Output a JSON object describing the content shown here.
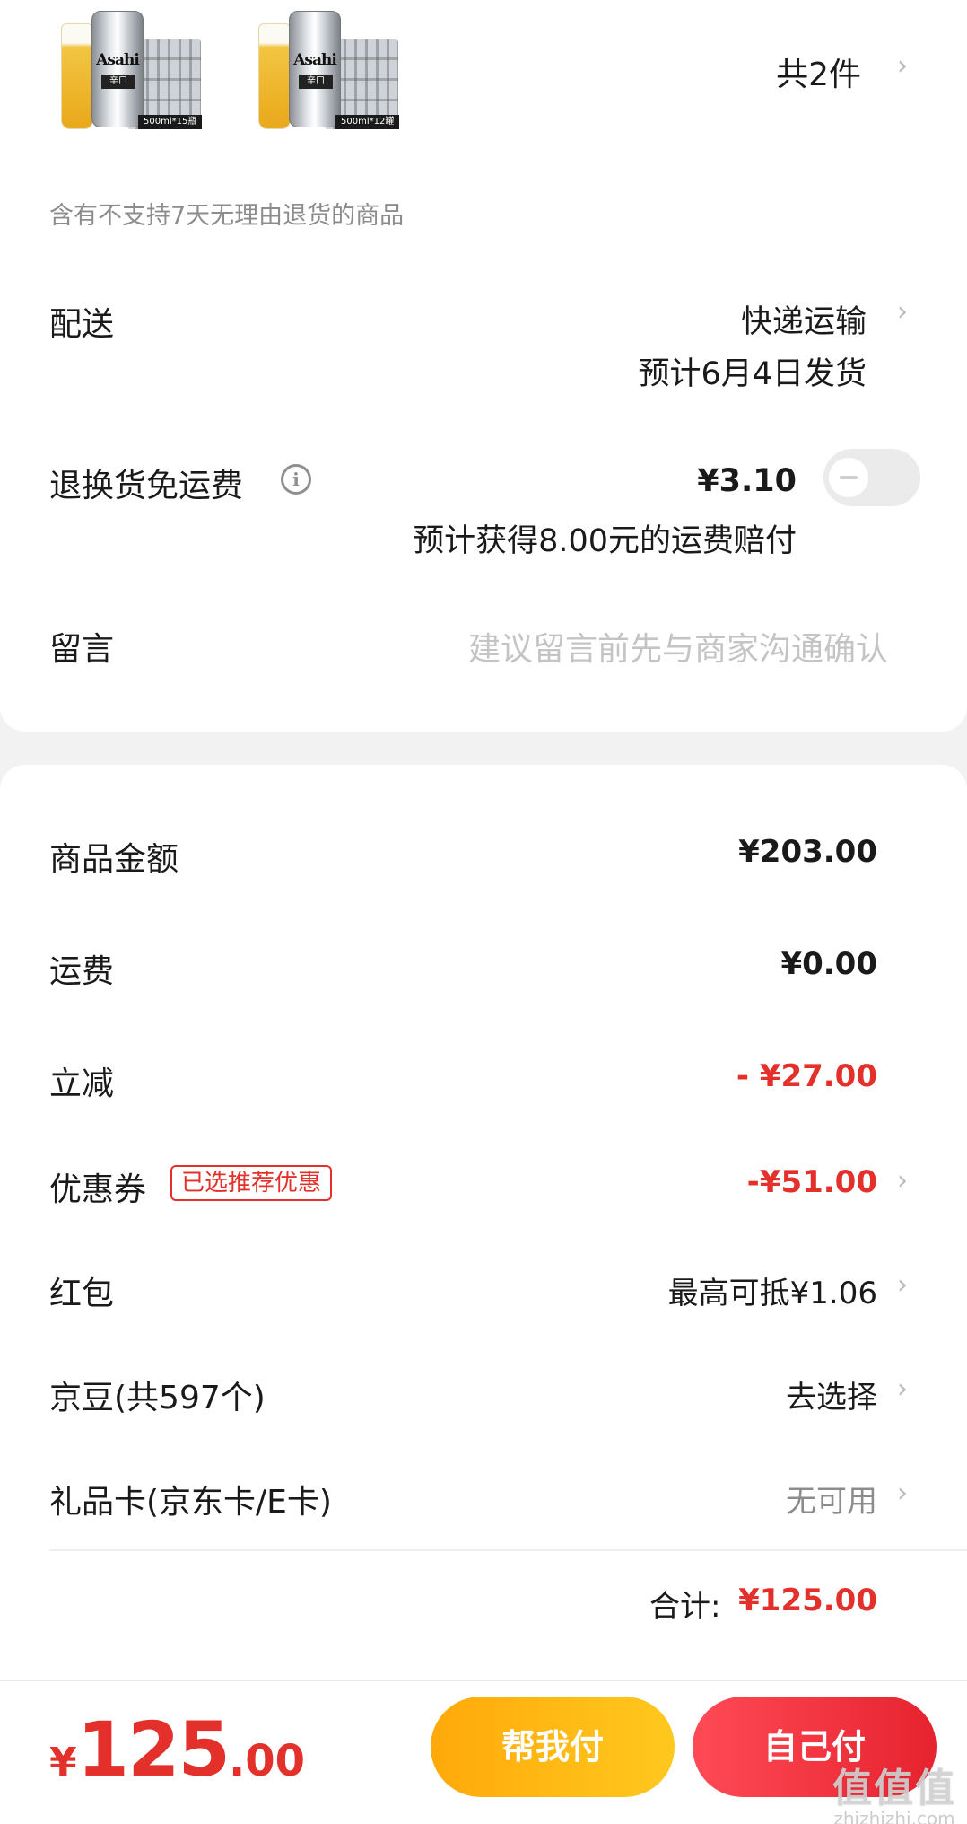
{
  "order": {
    "item_count": "共2件",
    "products": [
      {
        "brand": "Asahi",
        "can_text": "辛口",
        "pack": "500ml*15瓶"
      },
      {
        "brand": "Asahi",
        "can_text": "辛口",
        "pack": "500ml*12罐"
      }
    ],
    "return_notice": "含有不支持7天无理由退货的商品"
  },
  "delivery": {
    "label": "配送",
    "method": "快递运输",
    "eta": "预计6月4日发货"
  },
  "return_shipping": {
    "label": "退换货免运费",
    "price": "¥3.10",
    "compensation": "预计获得8.00元的运费赔付",
    "enabled": false
  },
  "message": {
    "label": "留言",
    "placeholder": "建议留言前先与商家沟通确认"
  },
  "summary": {
    "goods_label": "商品金额",
    "goods_amount": "¥203.00",
    "shipping_label": "运费",
    "shipping_amount": "¥0.00",
    "discount_label": "立减",
    "discount_amount": "- ¥27.00",
    "coupon_label": "优惠券",
    "coupon_tag": "已选推荐优惠",
    "coupon_amount": "-¥51.00",
    "redpacket_label": "红包",
    "redpacket_value": "最高可抵¥1.06",
    "jingdou_label": "京豆(共597个)",
    "jingdou_value": "去选择",
    "giftcard_label": "礼品卡(京东卡/E卡)",
    "giftcard_value": "无可用",
    "total_label": "合计:",
    "total_amount": "¥125.00"
  },
  "footer": {
    "price_symbol": "¥",
    "price_int": "125",
    "price_dec": ".00",
    "help_pay": "帮我付",
    "self_pay": "自己付"
  },
  "watermark": {
    "main": "值值值",
    "sub": "zhizhizhi.com"
  },
  "colors": {
    "accent_red": "#e4302b",
    "help_button": "#ffb514",
    "self_button": "#f2303a"
  }
}
